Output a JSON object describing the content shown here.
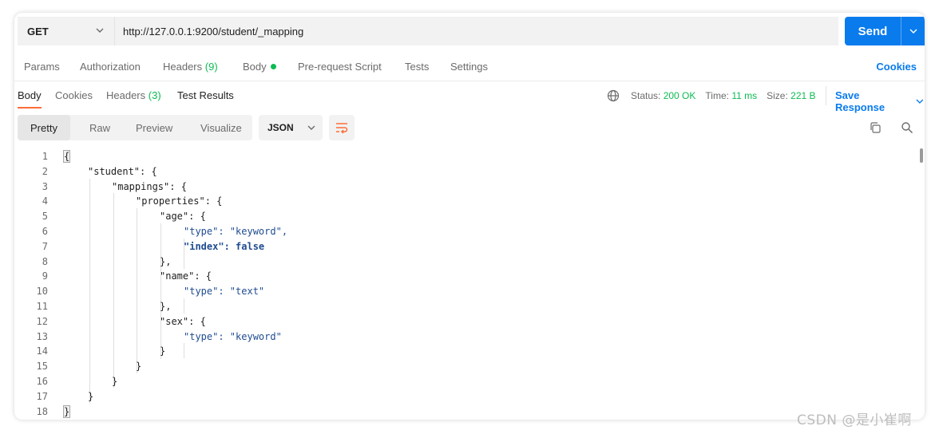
{
  "request": {
    "method": "GET",
    "url": "http://127.0.0.1:9200/student/_mapping",
    "send_label": "Send"
  },
  "request_tabs": {
    "params": "Params",
    "authorization": "Authorization",
    "headers": "Headers",
    "headers_count": "(9)",
    "body": "Body",
    "pre_request": "Pre-request Script",
    "tests": "Tests",
    "settings": "Settings",
    "cookies": "Cookies"
  },
  "response_tabs": {
    "body": "Body",
    "cookies": "Cookies",
    "headers": "Headers",
    "headers_count": "(3)",
    "test_results": "Test Results"
  },
  "response_meta": {
    "status_label": "Status:",
    "status_value": "200 OK",
    "time_label": "Time:",
    "time_value": "11 ms",
    "size_label": "Size:",
    "size_value": "221 B",
    "save_response": "Save Response"
  },
  "view_options": {
    "pretty": "Pretty",
    "raw": "Raw",
    "preview": "Preview",
    "visualize": "Visualize",
    "format": "JSON"
  },
  "code_lines": [
    "{",
    "\"student\": {",
    "\"mappings\": {",
    "\"properties\": {",
    "\"age\": {",
    "\"type\": \"keyword\",",
    "\"index\": false",
    "},",
    "\"name\": {",
    "\"type\": \"text\"",
    "},",
    "\"sex\": {",
    "\"type\": \"keyword\"",
    "}",
    "}",
    "}",
    "}",
    "}"
  ],
  "watermark": "CSDN @是小崔啊",
  "colors": {
    "accent_blue": "#097bed",
    "status_green": "#0cbb52",
    "tab_orange": "#ff6c37",
    "json_string": "#1f4c91"
  }
}
